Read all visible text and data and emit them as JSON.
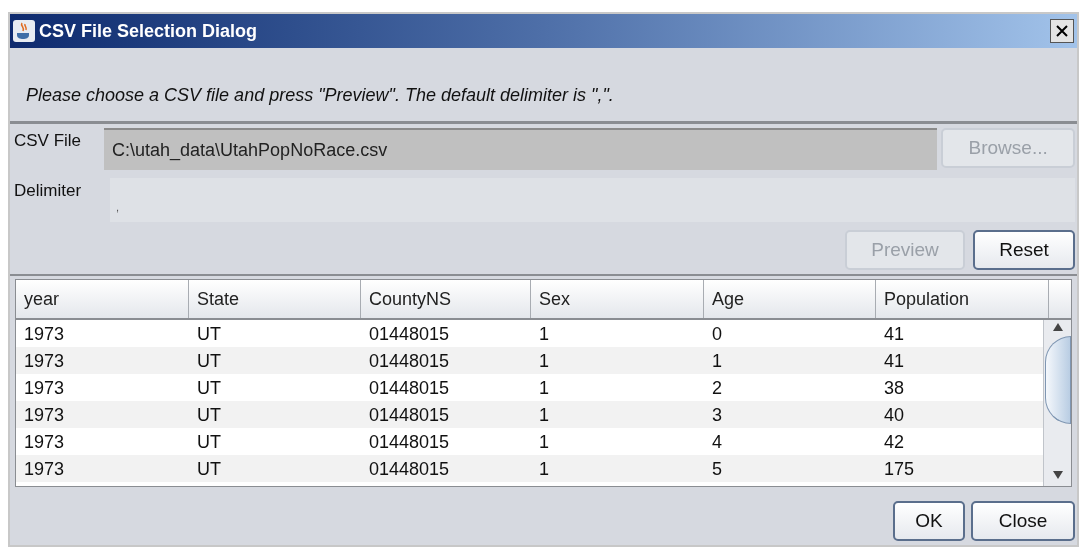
{
  "window": {
    "title": "CSV File Selection Dialog"
  },
  "instruction": "Please choose a CSV file and press \"Preview\". The default delimiter is \",\".",
  "csv_file": {
    "label": "CSV File",
    "value": "C:\\utah_data\\UtahPopNoRace.csv"
  },
  "browse_button": {
    "label": "Browse...",
    "disabled": true
  },
  "delimiter": {
    "label": "Delimiter",
    "value": ","
  },
  "action_buttons": [
    {
      "label": "Preview",
      "disabled": true
    },
    {
      "label": "Reset",
      "disabled": false
    }
  ],
  "table": {
    "columns": [
      "year",
      "State",
      "CountyNS",
      "Sex",
      "Age",
      "Population"
    ],
    "rows": [
      [
        "1973",
        "UT",
        "01448015",
        "1",
        "0",
        "41"
      ],
      [
        "1973",
        "UT",
        "01448015",
        "1",
        "1",
        "41"
      ],
      [
        "1973",
        "UT",
        "01448015",
        "1",
        "2",
        "38"
      ],
      [
        "1973",
        "UT",
        "01448015",
        "1",
        "3",
        "40"
      ],
      [
        "1973",
        "UT",
        "01448015",
        "1",
        "4",
        "42"
      ],
      [
        "1973",
        "UT",
        "01448015",
        "1",
        "5",
        "175"
      ]
    ]
  },
  "bottom_buttons": [
    {
      "label": "OK",
      "disabled": false
    },
    {
      "label": "Close",
      "disabled": false
    }
  ]
}
